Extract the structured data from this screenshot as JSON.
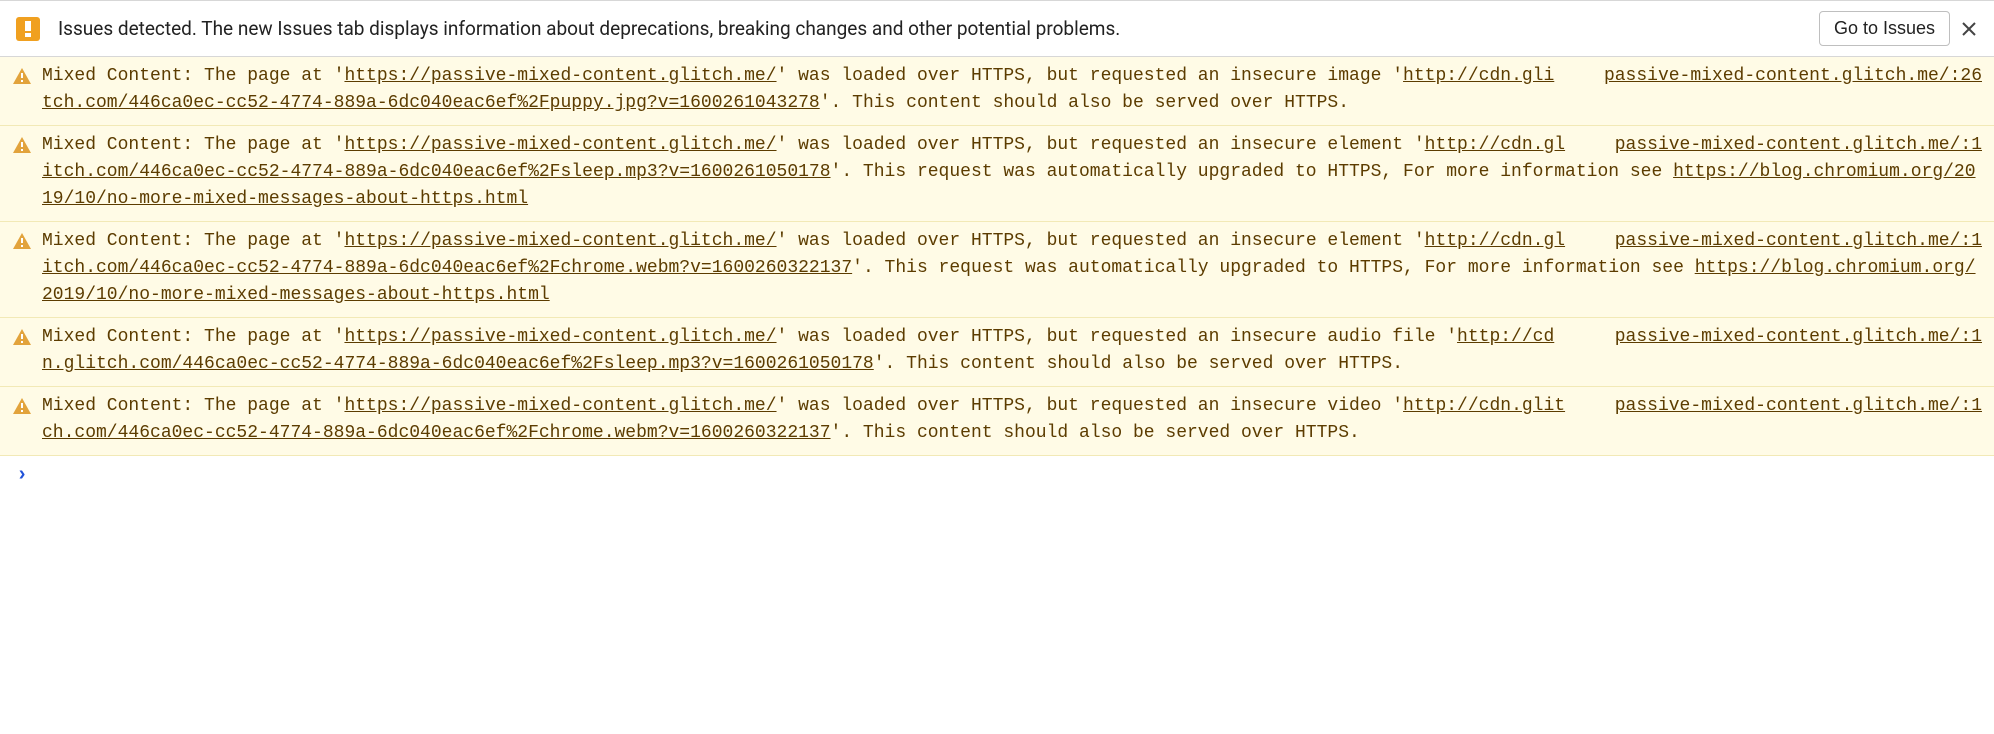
{
  "banner": {
    "text": "Issues detected. The new Issues tab displays information about deprecations, breaking changes and other potential problems.",
    "button": "Go to Issues"
  },
  "warnings": [
    {
      "source": "passive-mixed-content.glitch.me/:26",
      "t0": "Mixed Content: The page at '",
      "u0": "https://passive-mixed-content.glitch.me/",
      "t1": "' was loaded over HTTPS, but requested an insecure image '",
      "u1": "http://cdn.glitch.com/446ca0ec-cc52-4774-889a-6dc040eac6ef%2Fpuppy.jpg?v=1600261043278",
      "t2": "'. This content should also be served over HTTPS.",
      "u2": "",
      "t3": ""
    },
    {
      "source": "passive-mixed-content.glitch.me/:1",
      "t0": "Mixed Content: The page at '",
      "u0": "https://passive-mixed-content.glitch.me/",
      "t1": "' was loaded over HTTPS, but requested an insecure element '",
      "u1": "http://cdn.glitch.com/446ca0ec-cc52-4774-889a-6dc040eac6ef%2Fsleep.mp3?v=1600261050178",
      "t2": "'. This request was automatically upgraded to HTTPS, For more information see ",
      "u2": "https://blog.chromium.org/2019/10/no-more-mixed-messages-about-https.html",
      "t3": ""
    },
    {
      "source": "passive-mixed-content.glitch.me/:1",
      "t0": "Mixed Content: The page at '",
      "u0": "https://passive-mixed-content.glitch.me/",
      "t1": "' was loaded over HTTPS, but requested an insecure element '",
      "u1": "http://cdn.glitch.com/446ca0ec-cc52-4774-889a-6dc040eac6ef%2Fchrome.webm?v=1600260322137",
      "t2": "'. This request was automatically upgraded to HTTPS, For more information see ",
      "u2": "https://blog.chromium.org/2019/10/no-more-mixed-messages-about-https.html",
      "t3": ""
    },
    {
      "source": "passive-mixed-content.glitch.me/:1",
      "t0": "Mixed Content: The page at '",
      "u0": "https://passive-mixed-content.glitch.me/",
      "t1": "' was loaded over HTTPS, but requested an insecure audio file '",
      "u1": "http://cdn.glitch.com/446ca0ec-cc52-4774-889a-6dc040eac6ef%2Fsleep.mp3?v=1600261050178",
      "t2": "'. This content should also be served over HTTPS.",
      "u2": "",
      "t3": ""
    },
    {
      "source": "passive-mixed-content.glitch.me/:1",
      "t0": "Mixed Content: The page at '",
      "u0": "https://passive-mixed-content.glitch.me/",
      "t1": "' was loaded over HTTPS, but requested an insecure video '",
      "u1": "http://cdn.glitch.com/446ca0ec-cc52-4774-889a-6dc040eac6ef%2Fchrome.webm?v=1600260322137",
      "t2": "'. This content should also be served over HTTPS.",
      "u2": "",
      "t3": ""
    }
  ],
  "prompt": "›"
}
